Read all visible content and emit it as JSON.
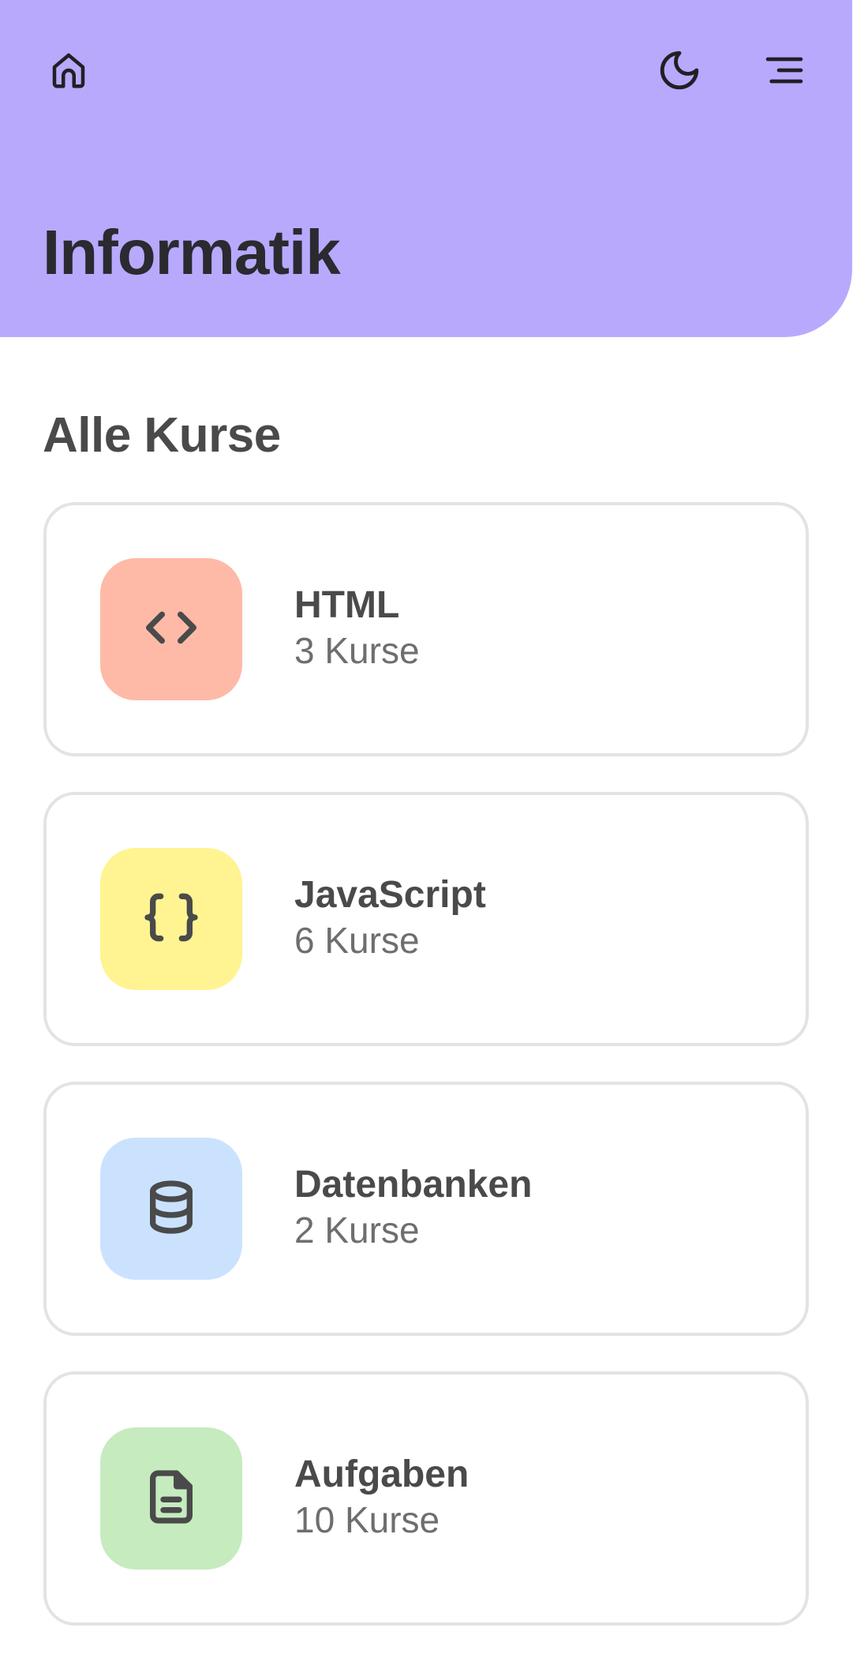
{
  "header": {
    "title": "Informatik",
    "background_color": "#b9a9fd",
    "icons": {
      "home": "home-icon",
      "theme": "moon-icon",
      "menu": "menu-icon"
    }
  },
  "main": {
    "section_title": "Alle Kurse",
    "courses": [
      {
        "name": "HTML",
        "count": "3 Kurse",
        "icon": "code-icon",
        "color": "#ffb9a7"
      },
      {
        "name": "JavaScript",
        "count": "6 Kurse",
        "icon": "braces-icon",
        "color": "#fff491"
      },
      {
        "name": "Datenbanken",
        "count": "2 Kurse",
        "icon": "database-icon",
        "color": "#cbe2fe"
      },
      {
        "name": "Aufgaben",
        "count": "10 Kurse",
        "icon": "document-icon",
        "color": "#c5ebbe"
      }
    ]
  }
}
